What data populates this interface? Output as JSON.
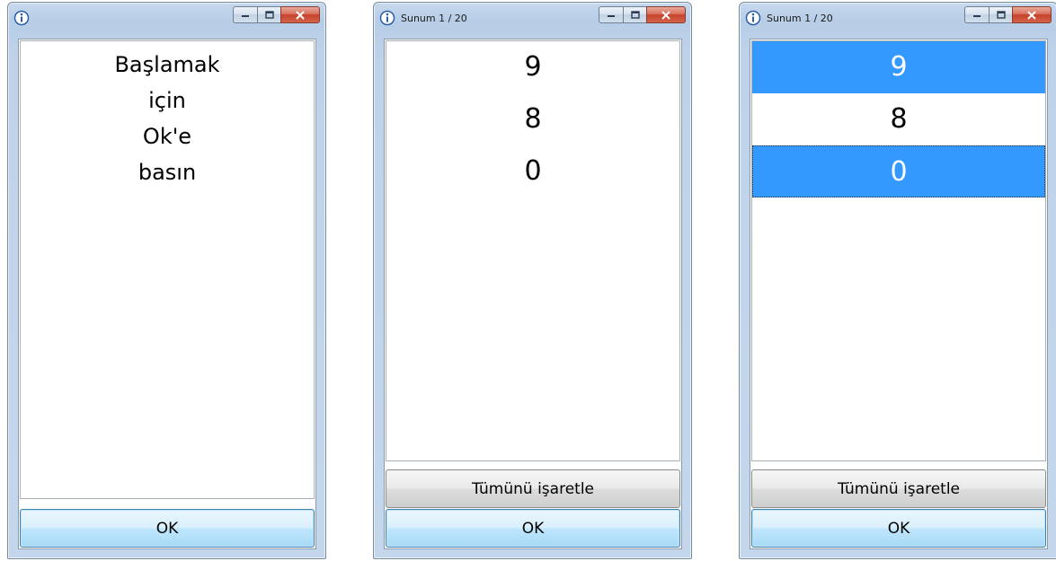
{
  "windows": [
    {
      "title": "",
      "message_lines": [
        "Başlamak",
        "için",
        "Ok'e",
        "basın"
      ],
      "ok_label": "OK"
    },
    {
      "title": "Sunum 1 / 20",
      "items": [
        "9",
        "8",
        "0"
      ],
      "mark_all_label": "Tümünü işaretle",
      "ok_label": "OK"
    },
    {
      "title": "Sunum 1 / 20",
      "items": [
        "9",
        "8",
        "0"
      ],
      "selected_items": [
        "9",
        "0"
      ],
      "mark_all_label": "Tümünü işaretle",
      "ok_label": "OK"
    }
  ],
  "colors": {
    "selection": "#3399ff",
    "close_button": "#c7412a",
    "window_frame": "#c3d6ec"
  },
  "icons": [
    "info-icon",
    "minimize-icon",
    "maximize-icon",
    "close-icon"
  ]
}
